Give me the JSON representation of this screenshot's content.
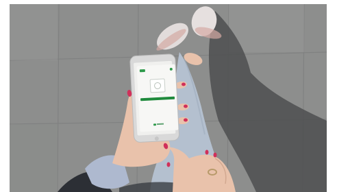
{
  "photo": {
    "subject": "hands-holding-smartphone",
    "colors": {
      "pavement": "#8d8e8d",
      "shadow": "#4e4f50",
      "jeans": "#b4c0cf",
      "skin": "#e9c2ab",
      "nails": "#d0305a",
      "sneaker": "#e2dcdb",
      "sneaker_sole": "#d4a9a4",
      "phone_body": "#d9d9d9",
      "screen": "#f7f7f5",
      "app_accent": "#2e9a4b",
      "jacket": "#2c2f35"
    }
  },
  "app": {
    "title": "",
    "cta_label": ""
  }
}
